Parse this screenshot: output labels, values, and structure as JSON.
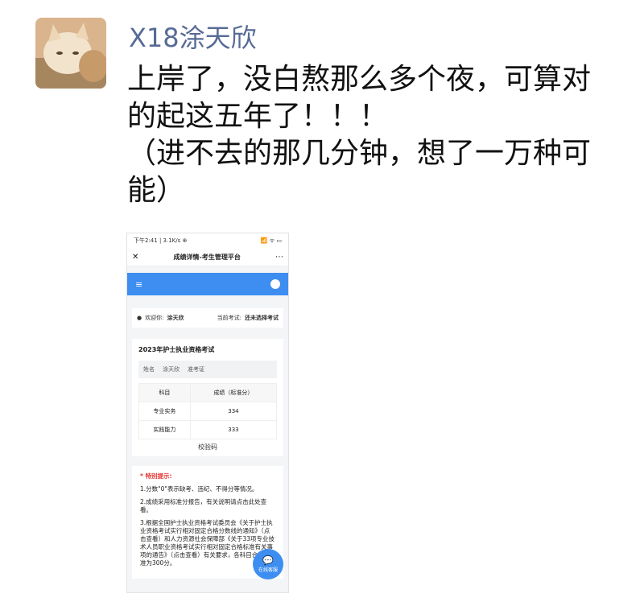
{
  "post": {
    "username": "X18涂天欣",
    "lines": [
      "上岸了，没白熬那么多个夜，可算对",
      "的起这五年了！！！",
      "（进不去的那几分钟，想了一万种可",
      "能）"
    ]
  },
  "screenshot": {
    "status_time": "下午2:41 | 3.1K/s ⊕",
    "status_icons": "📶 ᯤ ▭",
    "nav_title": "成绩详情-考生管理平台",
    "user_label": "欢迎你:",
    "user_name": "涂天欣",
    "exam_label": "当前考试:",
    "exam_value": "还未选择考试",
    "card_title": "2023年护士执业资格考试",
    "info": [
      "姓名",
      "涂天欣",
      "准考证"
    ],
    "table_headers": [
      "科目",
      "成绩（标准分）"
    ],
    "rows": [
      [
        "专业实务",
        "334"
      ],
      [
        "实践能力",
        "333"
      ]
    ],
    "verify": "校验码",
    "notice_head": "* 特别提示:",
    "notices": [
      "1.分数\"0\"表示缺考、违纪、不得分等情况。",
      "2.成绩采用标准分报告，有关说明请点击此处查看。",
      "3.根据全国护士执业资格考试委员会《关于护士执业资格考试实行相对固定合格分数线的通知》（点击查看）和人力资源社会保障部《关于33项专业技术人员职业资格考试实行相对固定合格标准有关事项的通告》（点击查看）有关要求，各科目合格标准为300分。"
    ],
    "fab_label": "在线客服"
  }
}
